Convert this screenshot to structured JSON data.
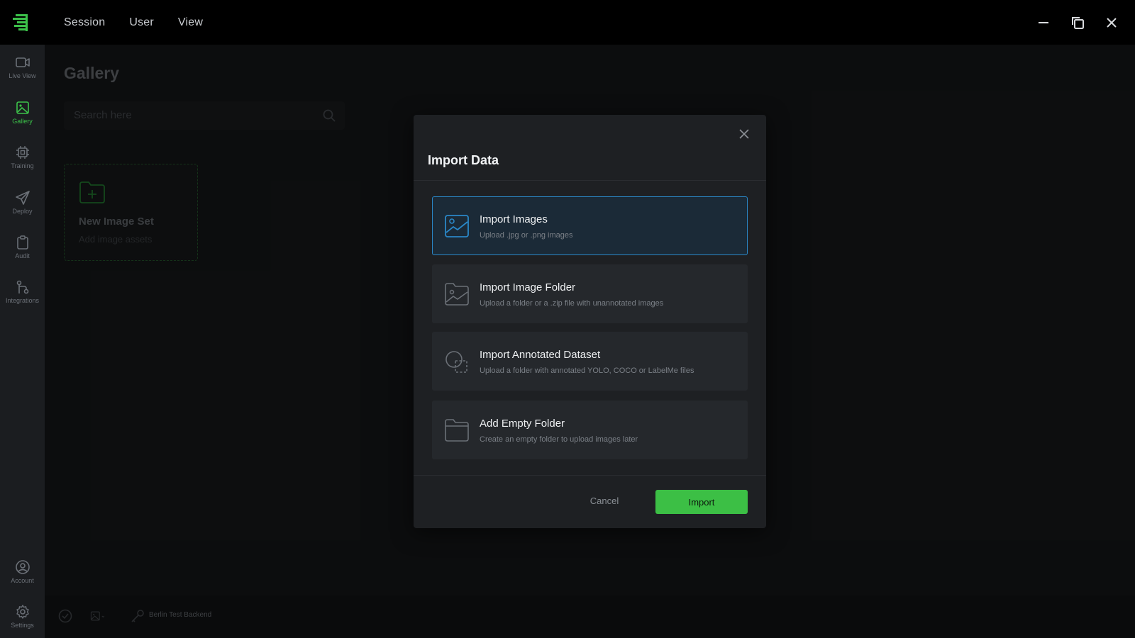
{
  "topbar": {
    "menu": [
      "Session",
      "User",
      "View"
    ],
    "window_controls": [
      "minimize-icon",
      "restore-icon",
      "close-icon"
    ]
  },
  "sidebar": {
    "items": [
      {
        "label": "Live View",
        "icon": "video-camera-icon",
        "active": false
      },
      {
        "label": "Gallery",
        "icon": "image-icon",
        "active": true
      },
      {
        "label": "Training",
        "icon": "chip-icon",
        "active": false
      },
      {
        "label": "Deploy",
        "icon": "send-icon",
        "active": false
      },
      {
        "label": "Audit",
        "icon": "clipboard-icon",
        "active": false
      },
      {
        "label": "Integrations",
        "icon": "git-icon",
        "active": false
      }
    ],
    "bottom_items": [
      {
        "label": "Account",
        "icon": "user-circle-icon"
      },
      {
        "label": "Settings",
        "icon": "gear-icon"
      }
    ]
  },
  "main": {
    "title": "Gallery",
    "search_placeholder": "Search here",
    "new_set": {
      "title": "New Image Set",
      "subtitle": "Add image assets"
    }
  },
  "statusbar": {
    "backend": "Berlin Test Backend"
  },
  "modal": {
    "title": "Import Data",
    "options": [
      {
        "title": "Import Images",
        "subtitle": "Upload .jpg or .png images",
        "selected": true
      },
      {
        "title": "Import Image Folder",
        "subtitle": "Upload a folder or a .zip file with unannotated images",
        "selected": false
      },
      {
        "title": "Import Annotated Dataset",
        "subtitle": "Upload a folder with annotated YOLO, COCO or LabelMe files",
        "selected": false
      },
      {
        "title": "Add Empty Folder",
        "subtitle": "Create an empty folder to upload images later",
        "selected": false
      }
    ],
    "cancel_label": "Cancel",
    "import_label": "Import"
  },
  "colors": {
    "accent": "#3cbf45",
    "selected_border": "#2a87c7",
    "selected_bg": "#1b2a37"
  }
}
